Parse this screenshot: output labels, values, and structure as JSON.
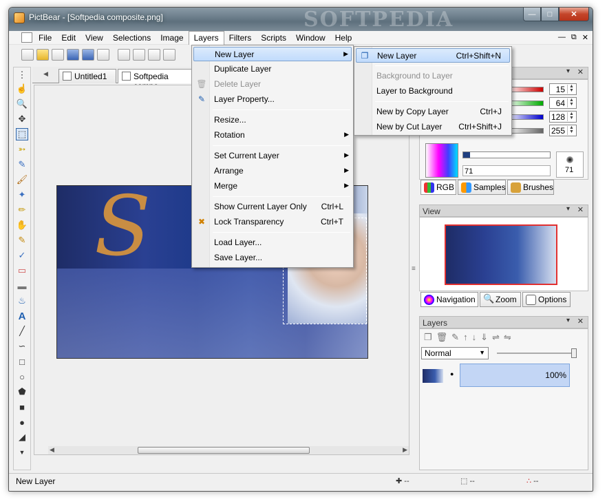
{
  "window": {
    "title": "PictBear - [Softpedia composite.png]",
    "watermark": "SOFTPEDIA"
  },
  "menubar": {
    "items": [
      "File",
      "Edit",
      "View",
      "Selections",
      "Image",
      "Layers",
      "Filters",
      "Scripts",
      "Window",
      "Help"
    ],
    "open_item": "Layers"
  },
  "tabs": {
    "items": [
      "Untitled1",
      "Softpedia compo"
    ]
  },
  "layers_menu": {
    "new_layer": "New Layer",
    "duplicate_layer": "Duplicate Layer",
    "delete_layer": "Delete Layer",
    "layer_property": "Layer Property...",
    "resize": "Resize...",
    "rotation": "Rotation",
    "set_current_layer": "Set Current Layer",
    "arrange": "Arrange",
    "merge": "Merge",
    "show_current_layer_only": "Show Current Layer Only",
    "show_current_layer_only_shortcut": "Ctrl+L",
    "lock_transparency": "Lock Transparency",
    "lock_transparency_shortcut": "Ctrl+T",
    "load_layer": "Load Layer...",
    "save_layer": "Save Layer..."
  },
  "new_layer_submenu": {
    "new_layer": "New Layer",
    "new_layer_shortcut": "Ctrl+Shift+N",
    "background_to_layer": "Background to Layer",
    "layer_to_background": "Layer to Background",
    "new_by_copy": "New by Copy Layer",
    "new_by_copy_shortcut": "Ctrl+J",
    "new_by_cut": "New by Cut Layer",
    "new_by_cut_shortcut": "Ctrl+Shift+J"
  },
  "color_panel": {
    "red_value": "15",
    "green_value": "64",
    "blue_value": "128",
    "alpha_value": "255",
    "opacity_value": "71",
    "brush_size": "71",
    "tabs": [
      "RGB",
      "Samples",
      "Brushes"
    ],
    "colors": {
      "red": "#cc0000",
      "green": "#00aa00",
      "blue": "#0000cc"
    }
  },
  "view_panel": {
    "title": "View",
    "tabs": [
      "Navigation",
      "Zoom",
      "Options"
    ]
  },
  "layers_panel": {
    "title": "Layers",
    "blend_mode": "Normal",
    "layer_opacity": "100%"
  },
  "status": {
    "text": "New Layer",
    "pos": "--",
    "size": "--",
    "color": "--"
  }
}
